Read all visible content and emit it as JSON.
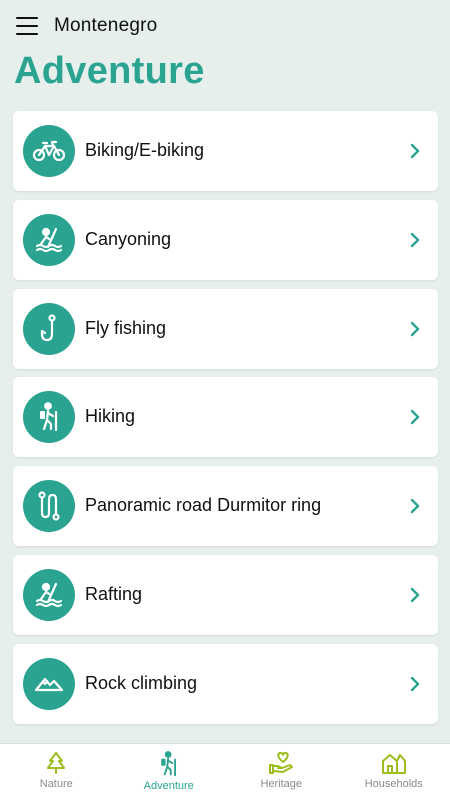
{
  "app_bar": {
    "title": "Montenegro"
  },
  "page": {
    "title": "Adventure"
  },
  "items": [
    {
      "label": "Biking/E-biking",
      "icon": "bicycle-icon"
    },
    {
      "label": "Canyoning",
      "icon": "canyoning-icon"
    },
    {
      "label": "Fly fishing",
      "icon": "fishing-hook-icon"
    },
    {
      "label": "Hiking",
      "icon": "hiker-icon"
    },
    {
      "label": "Panoramic road Durmitor ring",
      "icon": "winding-road-icon"
    },
    {
      "label": "Rafting",
      "icon": "rafting-icon"
    },
    {
      "label": "Rock climbing",
      "icon": "mountain-icon"
    }
  ],
  "bottom_nav": {
    "items": [
      {
        "label": "Nature",
        "icon": "tree-icon"
      },
      {
        "label": "Adventure",
        "icon": "hiker-icon",
        "active": true
      },
      {
        "label": "Heritage",
        "icon": "heart-hand-icon"
      },
      {
        "label": "Households",
        "icon": "houses-icon"
      }
    ]
  },
  "colors": {
    "accent": "#2aa491",
    "background": "#e6efec",
    "nav_icon": "#9bbe1e"
  }
}
